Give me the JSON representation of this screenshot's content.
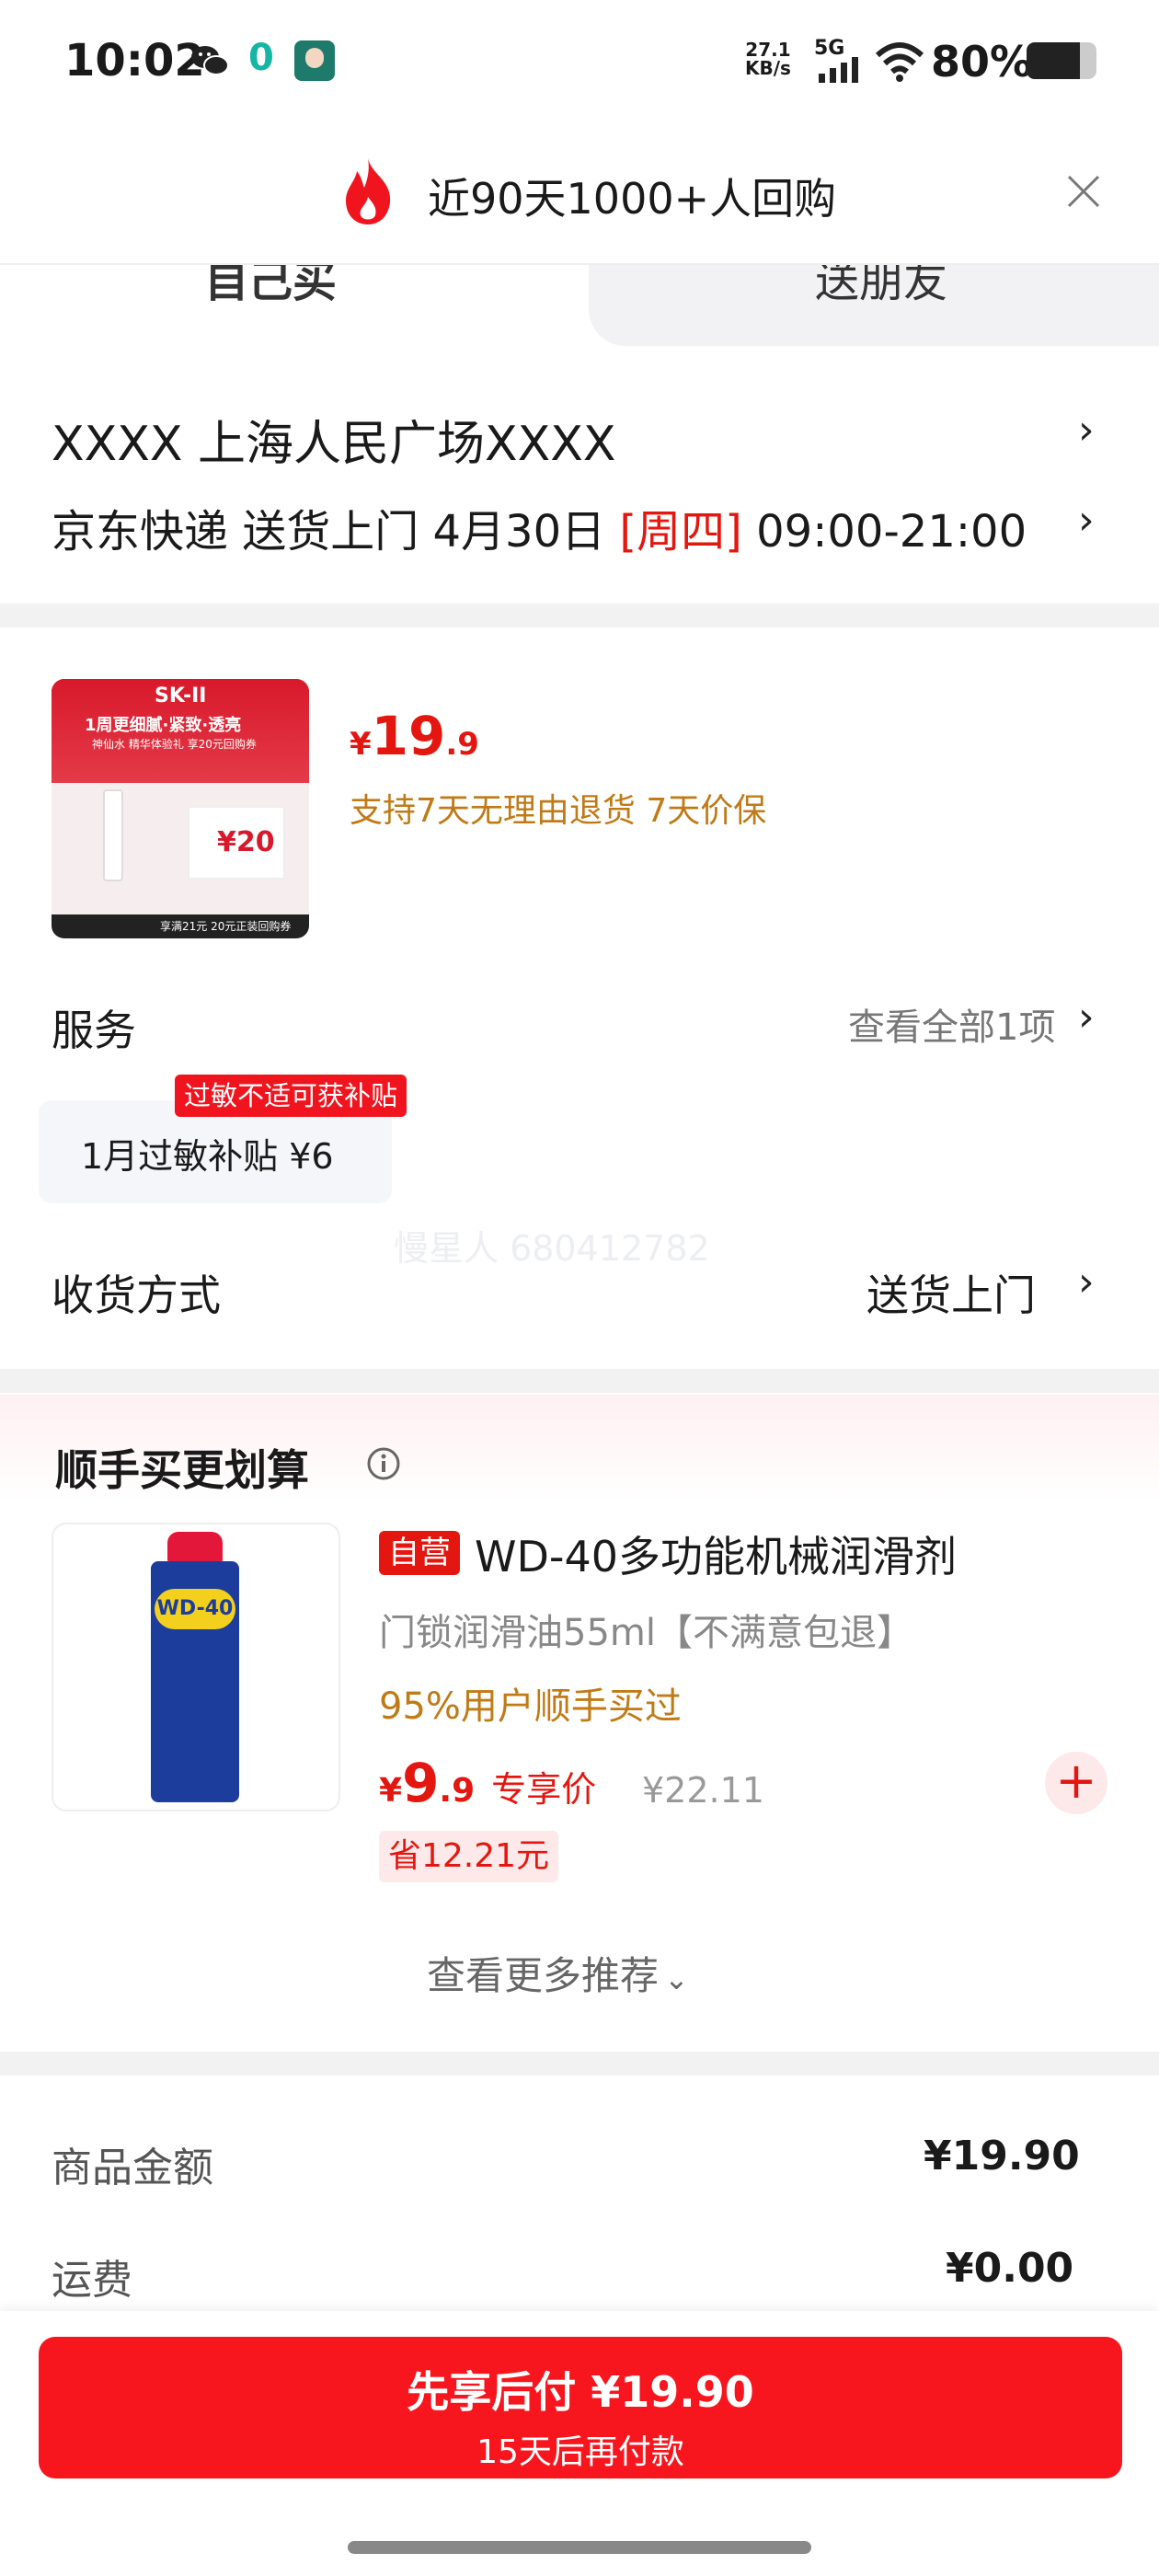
{
  "status_bar": {
    "time": "10:02",
    "notif_count": "0",
    "net_speed_value": "27.1",
    "net_speed_unit": "KB/s",
    "network": "5G",
    "battery": "80%"
  },
  "banner": {
    "text": "近90天1000+人回购",
    "icon": "fire-icon"
  },
  "tabs": [
    {
      "label": "自己买"
    },
    {
      "label": "送朋友"
    }
  ],
  "address": {
    "line": "XXXX  上海人民广场XXXX",
    "delivery_prefix": "京东快递 送货上门 4月30日 ",
    "delivery_weekday": "[周四]",
    "delivery_time": " 09:00-21:00"
  },
  "product": {
    "image_texts": {
      "brand": "SK-II",
      "headline": "1周更细腻·紧致·透亮",
      "subline": "神仙水 精华体验礼 享20元回购券",
      "coupon": "¥20",
      "footer": "享满21元 20元正装回购券"
    },
    "price_symbol": "¥",
    "price_int": "19",
    "price_dec": ".9",
    "guarantee": "支持7天无理由退货  7天价保"
  },
  "service": {
    "label": "服务",
    "link": "查看全部1项",
    "chip_tag": "过敏不适可获补贴",
    "chip_text": "1月过敏补贴  ¥6"
  },
  "watermark": "慢星人 680412782",
  "shipping": {
    "label": "收货方式",
    "value": "送货上门"
  },
  "recommend": {
    "title": "顺手买更划算",
    "item": {
      "badge": "自营",
      "title": "WD-40多功能机械润滑剂",
      "subtitle": "门锁润滑油55ml【不满意包退】",
      "social": "95%用户顺手买过",
      "price_symbol": "¥",
      "price_int": "9",
      "price_dec": ".9",
      "price_label": "专享价",
      "orig_price": "¥22.11",
      "save": "省12.21元",
      "image_brand": "WD-40"
    },
    "more": "查看更多推荐"
  },
  "summary": {
    "rows": [
      {
        "label": "商品金额",
        "value": "¥19.90"
      },
      {
        "label": "运费",
        "value": "¥0.00"
      }
    ]
  },
  "pay": {
    "main": "先享后付 ¥19.90",
    "sub": "15天后再付款"
  },
  "colors": {
    "accent": "#e3170f",
    "gold": "#c07a16",
    "button": "#f7161e"
  }
}
